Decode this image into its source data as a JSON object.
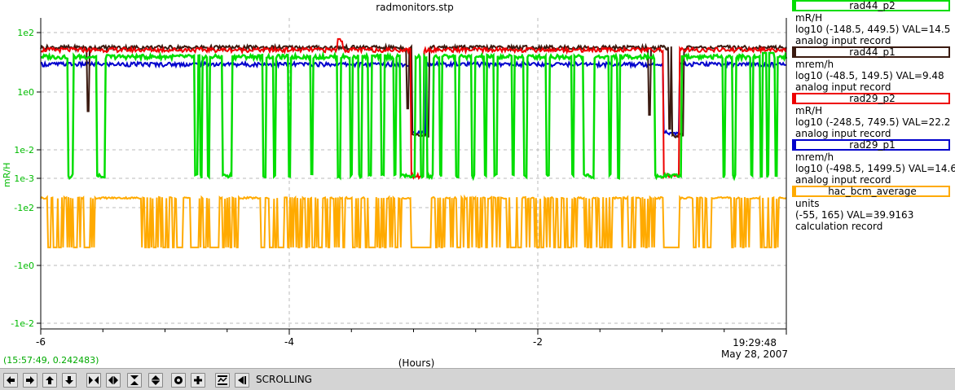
{
  "chart_title": "radmonitors.stp",
  "cursor_readout": "(15:57:49, 0.242483)",
  "end_time": "19:29:48",
  "end_date": "May 28, 2007",
  "toolbar": {
    "scrolling_label": "SCROLLING",
    "buttons": [
      "pan-left-icon",
      "pan-right-icon",
      "pan-up-icon",
      "pan-down-icon",
      "zoom-in-x-icon",
      "zoom-out-x-icon",
      "zoom-in-y-icon",
      "zoom-out-y-icon",
      "config-icon",
      "add-icon",
      "auto-scale-icon",
      "back-icon"
    ]
  },
  "legend": [
    {
      "name": "rad44_p2",
      "color": "#00dd00",
      "units": "mR/H",
      "scale": "log10 (-148.5, 449.5) VAL=14.5",
      "type": "analog input record"
    },
    {
      "name": "rad44_p1",
      "color": "#3a1a10",
      "units": "mrem/h",
      "scale": "log10 (-48.5, 149.5) VAL=9.48",
      "type": "analog input record"
    },
    {
      "name": "rad29_p2",
      "color": "#ee0000",
      "units": "mR/H",
      "scale": "log10 (-248.5, 749.5) VAL=22.2",
      "type": "analog input record"
    },
    {
      "name": "rad29_p1",
      "color": "#0000cc",
      "units": "mrem/h",
      "scale": "log10 (-498.5, 1499.5) VAL=14.6",
      "type": "analog input record"
    },
    {
      "name": "hac_bcm_average",
      "color": "#ffaa00",
      "units": "units",
      "scale": "(-55, 165) VAL=39.9163",
      "type": "calculation record"
    }
  ],
  "chart_data": {
    "type": "line",
    "title": "radmonitors.stp",
    "xlabel": "(Hours)",
    "ylabel": "mR/H",
    "x_ticks": [
      "-6",
      "-4",
      "-2"
    ],
    "y_ticks": [
      "1e2",
      "1e0",
      "1e-2",
      "1e-3",
      "-1e2",
      "-1e0",
      "-1e-2"
    ],
    "xlim": [
      -6,
      0
    ],
    "grid": true,
    "legend_position": "right",
    "series": [
      {
        "name": "rad44_p2",
        "color": "#00dd00",
        "scale": "log",
        "base": 14.5,
        "low": 0.001,
        "dips": [
          [
            -5.78,
            -5.74
          ],
          [
            -5.55,
            -5.48
          ],
          [
            -4.76,
            -4.74
          ],
          [
            -4.72,
            -4.7
          ],
          [
            -4.66,
            -4.64
          ],
          [
            -4.54,
            -4.46
          ],
          [
            -4.21,
            -4.19
          ],
          [
            -4.13,
            -4.11
          ],
          [
            -4.01,
            -3.99
          ],
          [
            -3.83,
            -3.81
          ],
          [
            -3.61,
            -3.59
          ],
          [
            -3.51,
            -3.49
          ],
          [
            -3.44,
            -3.42
          ],
          [
            -3.36,
            -3.34
          ],
          [
            -3.26,
            -3.24
          ],
          [
            -3.16,
            -3.14
          ],
          [
            -3.11,
            -2.99
          ],
          [
            -2.94,
            -2.92
          ],
          [
            -2.89,
            -2.84
          ],
          [
            -2.79,
            -2.77
          ],
          [
            -2.66,
            -2.64
          ],
          [
            -2.53,
            -2.51
          ],
          [
            -2.43,
            -2.41
          ],
          [
            -2.35,
            -2.33
          ],
          [
            -2.21,
            -2.19
          ],
          [
            -2.11,
            -2.09
          ],
          [
            -1.93,
            -1.91
          ],
          [
            -1.73,
            -1.71
          ],
          [
            -1.63,
            -1.55
          ],
          [
            -1.43,
            -1.41
          ],
          [
            -1.36,
            -1.34
          ],
          [
            -1.06,
            -0.84
          ],
          [
            -0.51,
            -0.49
          ],
          [
            -0.43,
            -0.41
          ],
          [
            -0.29,
            -0.27
          ],
          [
            -0.21,
            -0.19
          ],
          [
            -0.16,
            -0.14
          ],
          [
            -0.09,
            -0.07
          ]
        ],
        "bumps": [
          [
            -0.2,
            -0.1,
            20
          ]
        ]
      },
      {
        "name": "rad44_p1",
        "color": "#3a1a10",
        "scale": "log",
        "base": 30.0,
        "low": 0.025,
        "dips": [
          [
            -3.01,
            -2.88
          ],
          [
            -0.92,
            -0.83
          ]
        ],
        "spikes": [
          [
            -5.62,
            0.2
          ],
          [
            -3.05,
            0.25
          ],
          [
            -1.1,
            0.15
          ],
          [
            -0.94,
            0.05
          ]
        ]
      },
      {
        "name": "rad29_p2",
        "color": "#ee0000",
        "scale": "log",
        "base": 25.0,
        "low": 0.001,
        "dips": [
          [
            -3.02,
            -2.92
          ],
          [
            -0.99,
            -0.86
          ]
        ],
        "spikes": [
          [
            -3.6,
            60.0
          ],
          [
            -3.58,
            50.0
          ]
        ]
      },
      {
        "name": "rad29_p1",
        "color": "#0000cc",
        "scale": "log",
        "base": 8.0,
        "low": 0.03,
        "dips": [
          [
            -3.02,
            -2.9
          ],
          [
            -0.99,
            -0.86
          ]
        ]
      },
      {
        "name": "hac_bcm_average",
        "color": "#ffaa00",
        "scale": "linear",
        "base": 154.0,
        "low": 72.0,
        "flat_low": [
          [
            -3.02,
            -2.86
          ],
          [
            -0.99,
            -0.86
          ]
        ],
        "burst_regions": [
          [
            -5.95,
            -5.55
          ],
          [
            -5.2,
            -4.4
          ],
          [
            -4.25,
            -3.55
          ],
          [
            -3.5,
            -3.1
          ],
          [
            -2.84,
            -2.3
          ],
          [
            -2.25,
            -1.4
          ],
          [
            -1.35,
            -1.05
          ],
          [
            -0.8,
            -0.6
          ],
          [
            -0.45,
            -0.05
          ]
        ]
      }
    ]
  }
}
